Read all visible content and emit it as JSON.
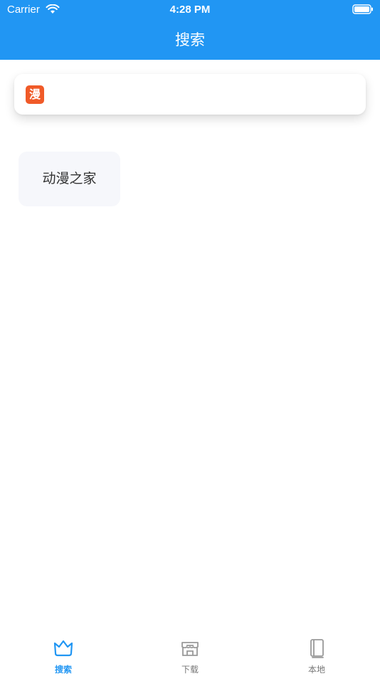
{
  "status_bar": {
    "carrier": "Carrier",
    "time": "4:28 PM"
  },
  "header": {
    "title": "搜索"
  },
  "source": {
    "logo_text": "漫",
    "logo_color": "#f05a28"
  },
  "history": {
    "items": [
      "动漫之家"
    ]
  },
  "tabs": [
    {
      "label": "搜索",
      "icon": "crown-icon",
      "active": true
    },
    {
      "label": "下载",
      "icon": "store-icon",
      "active": false
    },
    {
      "label": "本地",
      "icon": "book-icon",
      "active": false
    }
  ],
  "colors": {
    "accent": "#2196f3",
    "inactive": "#777777"
  }
}
